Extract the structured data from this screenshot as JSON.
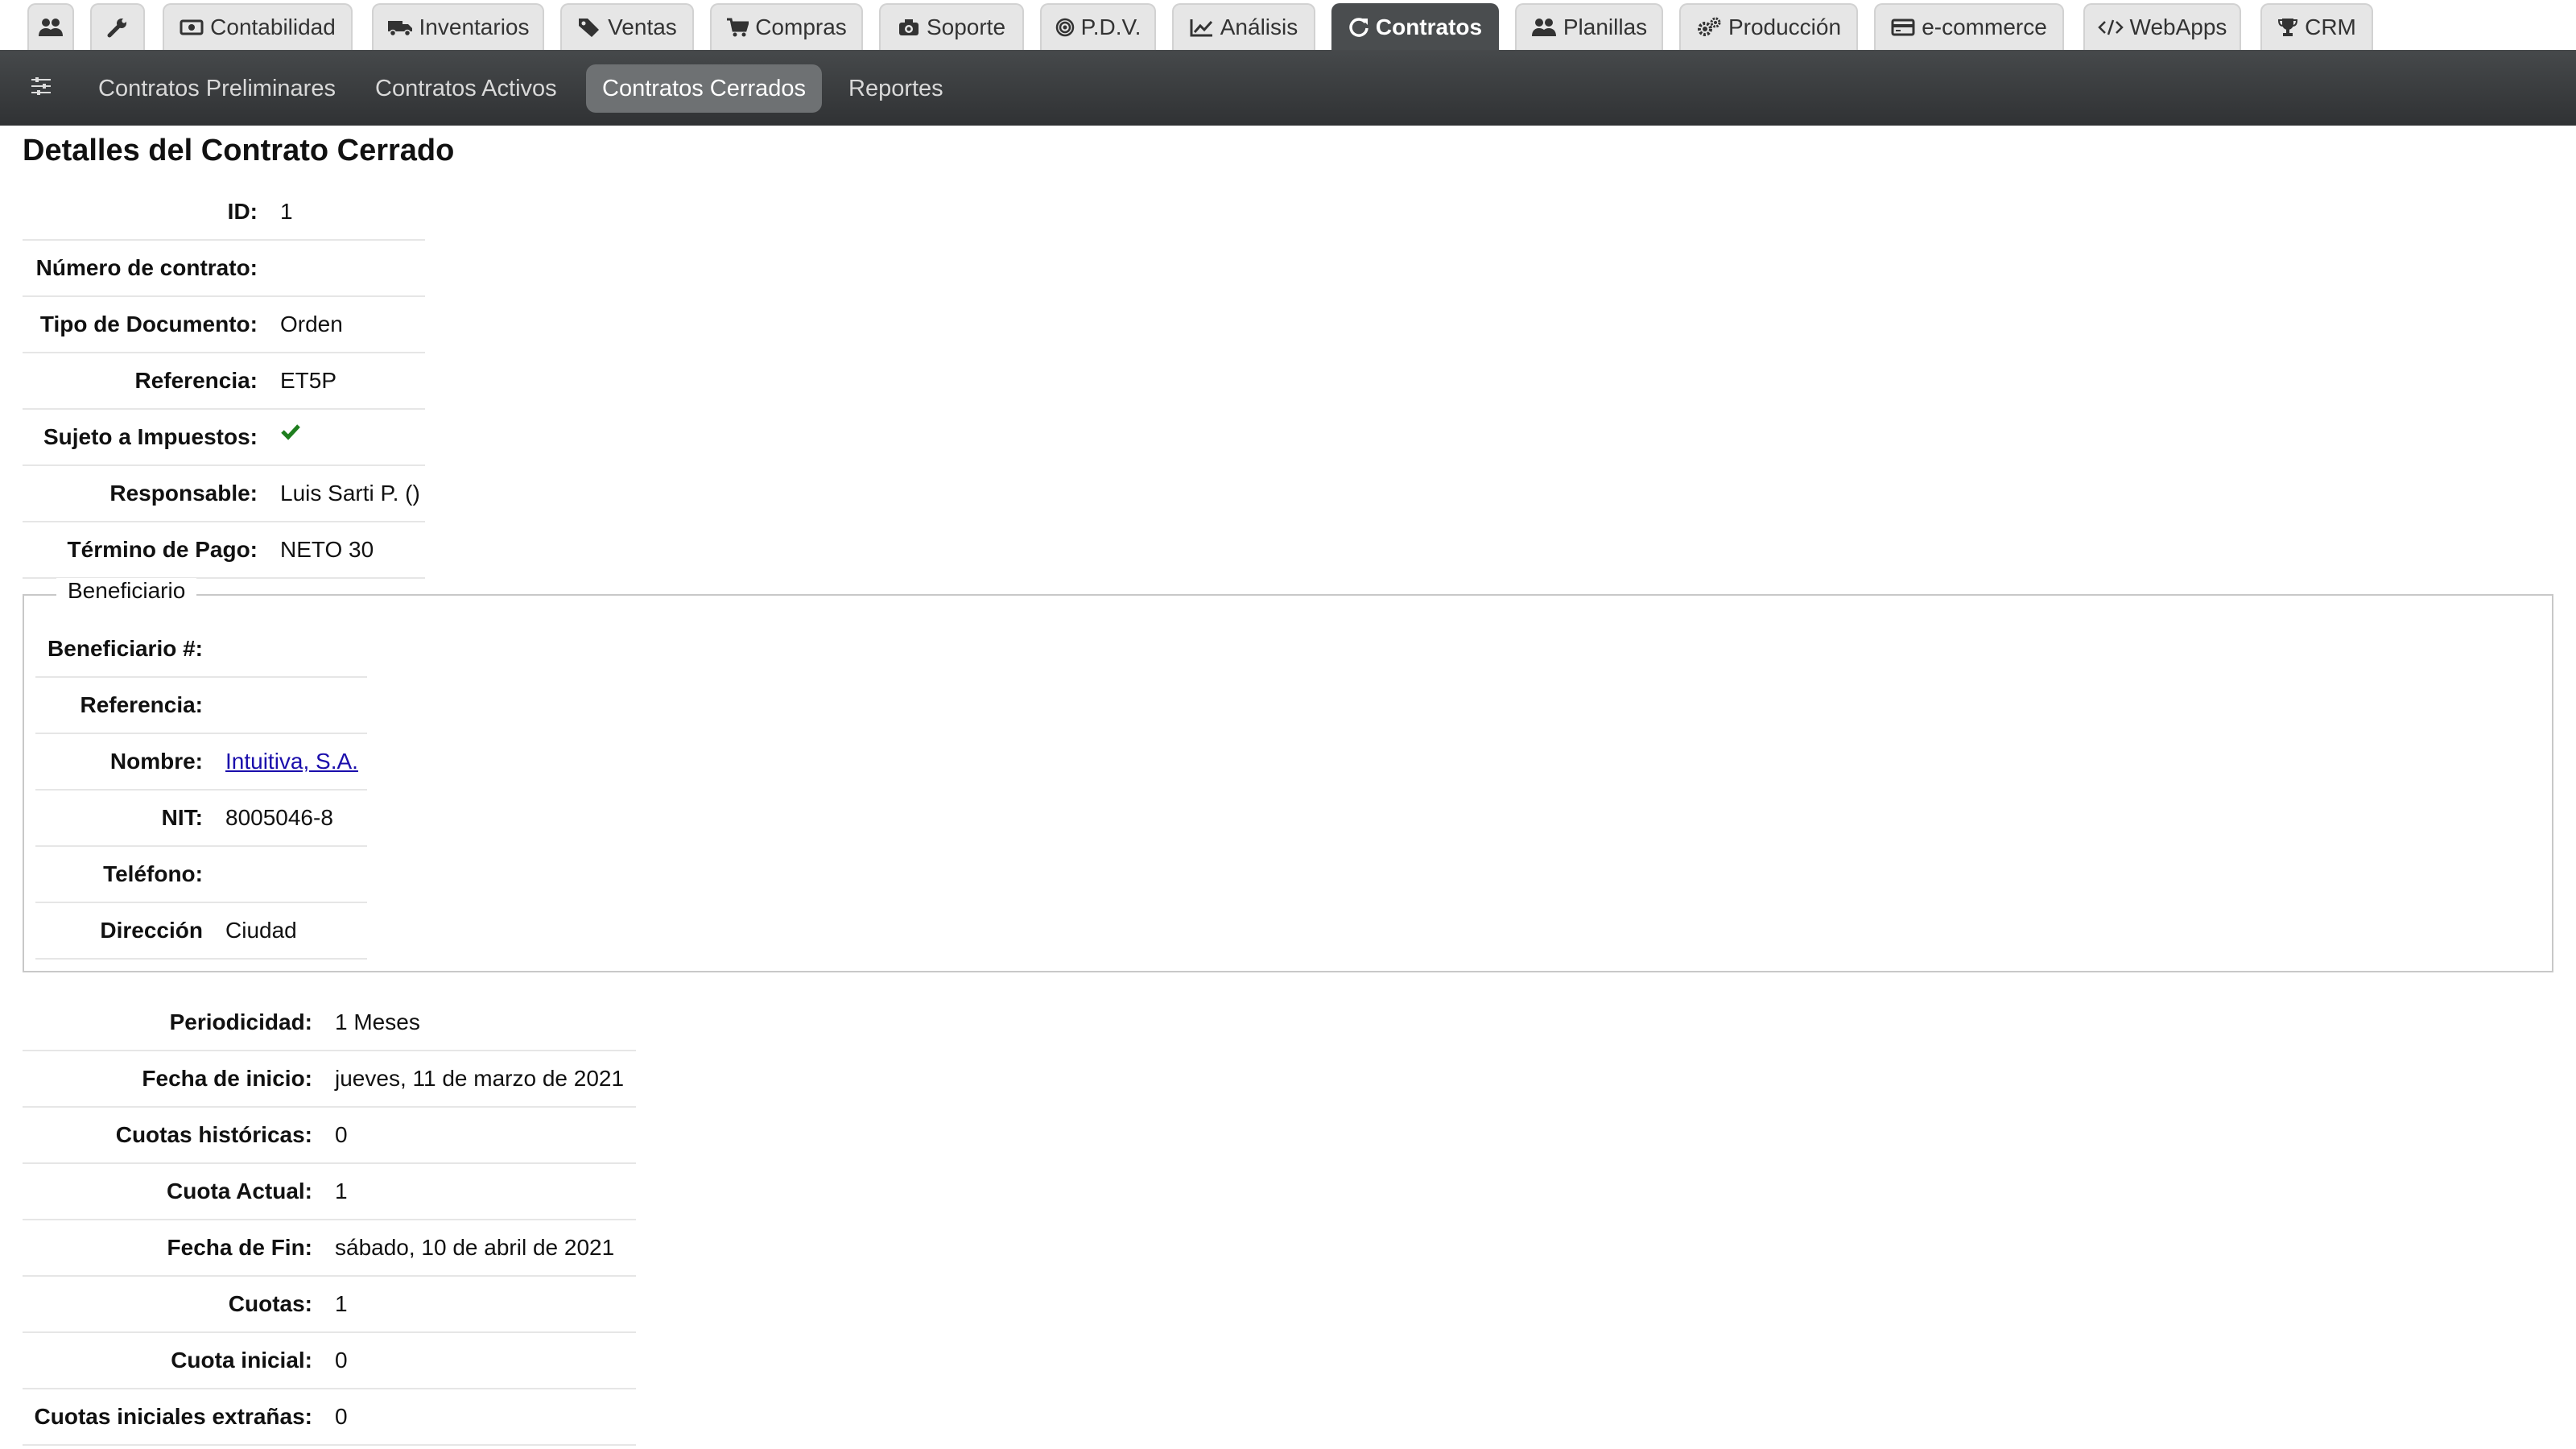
{
  "top_tabs": [
    {
      "id": "users",
      "label": "",
      "icon": "users-icon"
    },
    {
      "id": "tools",
      "label": "",
      "icon": "wrench-icon"
    },
    {
      "id": "accounting",
      "label": "Contabilidad",
      "icon": "money-icon"
    },
    {
      "id": "inventory",
      "label": "Inventarios",
      "icon": "truck-icon"
    },
    {
      "id": "sales",
      "label": "Ventas",
      "icon": "tags-icon"
    },
    {
      "id": "purchases",
      "label": "Compras",
      "icon": "cart-icon"
    },
    {
      "id": "support",
      "label": "Soporte",
      "icon": "camera-icon"
    },
    {
      "id": "pos",
      "label": "P.D.V.",
      "icon": "target-icon"
    },
    {
      "id": "analysis",
      "label": "Análisis",
      "icon": "line-chart-icon"
    },
    {
      "id": "contracts",
      "label": "Contratos",
      "icon": "refresh-icon",
      "active": true
    },
    {
      "id": "payroll",
      "label": "Planillas",
      "icon": "users-icon"
    },
    {
      "id": "production",
      "label": "Producción",
      "icon": "gears-icon"
    },
    {
      "id": "ecommerce",
      "label": "e-commerce",
      "icon": "credit-card-icon"
    },
    {
      "id": "webapps",
      "label": "WebApps",
      "icon": "code-icon"
    },
    {
      "id": "crm",
      "label": "CRM",
      "icon": "trophy-icon"
    }
  ],
  "sub_nav": {
    "filter_icon": "sliders-icon",
    "links": [
      {
        "label": "Contratos Preliminares"
      },
      {
        "label": "Contratos Activos"
      },
      {
        "label": "Contratos Cerrados",
        "active": true
      },
      {
        "label": "Reportes"
      }
    ]
  },
  "page": {
    "title": "Detalles del Contrato Cerrado",
    "details": [
      {
        "label": "ID:",
        "value": "1"
      },
      {
        "label": "Número de contrato:",
        "value": ""
      },
      {
        "label": "Tipo de Documento:",
        "value": "Orden"
      },
      {
        "label": "Referencia:",
        "value": "ET5P"
      },
      {
        "label": "Sujeto a Impuestos:",
        "value": "",
        "icon": "check-icon"
      },
      {
        "label": "Responsable:",
        "value": "Luis Sarti P. ()"
      },
      {
        "label": "Término de Pago:",
        "value": "NETO 30"
      }
    ],
    "beneficiary": {
      "legend": "Beneficiario",
      "rows": [
        {
          "label": "Beneficiario #:",
          "value": ""
        },
        {
          "label": "Referencia:",
          "value": ""
        },
        {
          "label": "Nombre:",
          "value": "Intuitiva, S.A.",
          "link": true
        },
        {
          "label": "NIT:",
          "value": "8005046-8"
        },
        {
          "label": "Teléfono:",
          "value": ""
        },
        {
          "label": "Dirección",
          "value": "Ciudad"
        }
      ]
    },
    "schedule": [
      {
        "label": "Periodicidad:",
        "value": "1 Meses"
      },
      {
        "label": "Fecha de inicio:",
        "value": "jueves, 11 de marzo de 2021"
      },
      {
        "label": "Cuotas históricas:",
        "value": "0"
      },
      {
        "label": "Cuota Actual:",
        "value": "1"
      },
      {
        "label": "Fecha de Fin:",
        "value": "sábado, 10 de abril de 2021"
      },
      {
        "label": "Cuotas:",
        "value": "1"
      },
      {
        "label": "Cuota inicial:",
        "value": "0"
      },
      {
        "label": "Cuotas iniciales extrañas:",
        "value": "0"
      }
    ]
  },
  "colors": {
    "check": "#1e7e1e",
    "link": "#1a0dab",
    "active_tab": "#4a4d4f",
    "navbar": "#3a3d3f"
  }
}
